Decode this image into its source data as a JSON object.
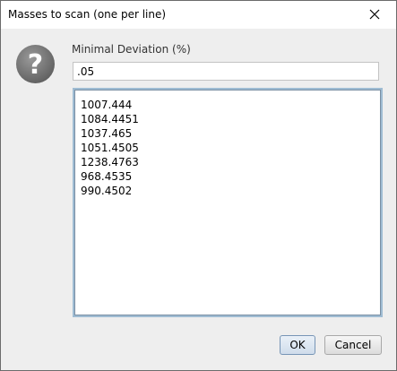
{
  "window": {
    "title": "Masses to scan (one per line)"
  },
  "icons": {
    "question": "question-icon",
    "close": "close-icon"
  },
  "form": {
    "deviation_label": "Minimal Deviation (%)",
    "deviation_value": ".05",
    "masses_text": "1007.444\n1084.4451\n1037.465\n1051.4505\n1238.4763\n968.4535\n990.4502"
  },
  "buttons": {
    "ok_label": "OK",
    "cancel_label": "Cancel"
  },
  "colors": {
    "dialog_bg": "#eeeeee",
    "focus_border": "#9fbcd3",
    "default_button_border": "#7795b6"
  }
}
